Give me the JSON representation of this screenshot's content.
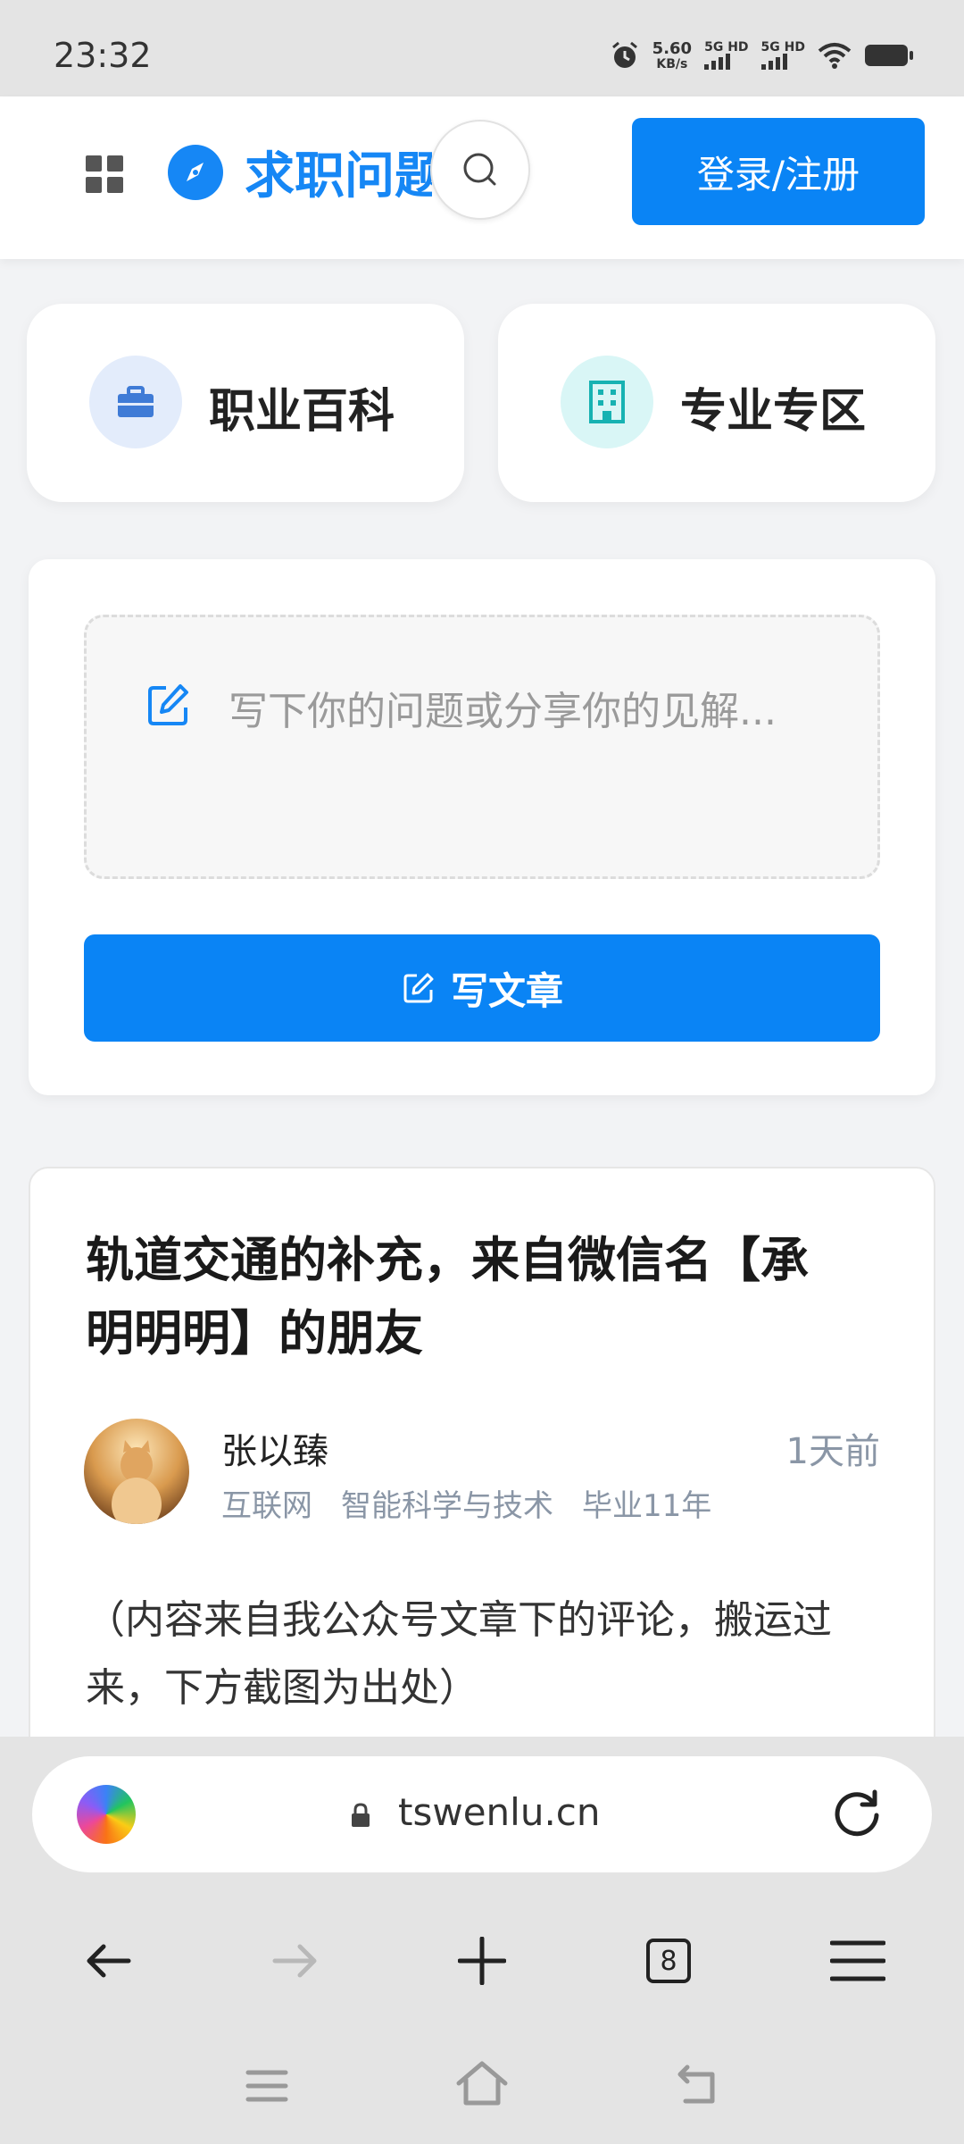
{
  "status_bar": {
    "time": "23:32",
    "net_speed_value": "5.60",
    "net_speed_unit": "KB/s",
    "sim1_label": "5G HD",
    "sim2_label": "5G HD",
    "icons": [
      "alarm-icon",
      "signal-icon",
      "wifi-icon",
      "battery-icon"
    ]
  },
  "header": {
    "menu_icon": "grid-icon",
    "logo_icon": "compass-icon",
    "site_title": "求职问题",
    "search_icon": "search-icon",
    "login_label": "登录/注册"
  },
  "categories": [
    {
      "label": "职业百科",
      "icon": "briefcase-icon",
      "icon_bg": "#e3ecfb",
      "icon_color": "#3f7bd6"
    },
    {
      "label": "专业专区",
      "icon": "building-icon",
      "icon_bg": "#d9f6f6",
      "icon_color": "#17b2b2"
    }
  ],
  "composer": {
    "placeholder": "写下你的问题或分享你的见解...",
    "write_label": "写文章"
  },
  "article": {
    "title": "轨道交通的补充，来自微信名【承明明明】的朋友",
    "author": "张以臻",
    "time_ago": "1天前",
    "tags": [
      "互联网",
      "智能科学与技术",
      "毕业11年"
    ],
    "excerpt": "（内容来自我公众号文章下的评论，搬运过来，下方截图为出处）"
  },
  "browser": {
    "url": "tswenlu.cn",
    "tab_count": "8"
  },
  "colors": {
    "accent": "#0a84f5",
    "muted_text": "#8a96a6"
  }
}
